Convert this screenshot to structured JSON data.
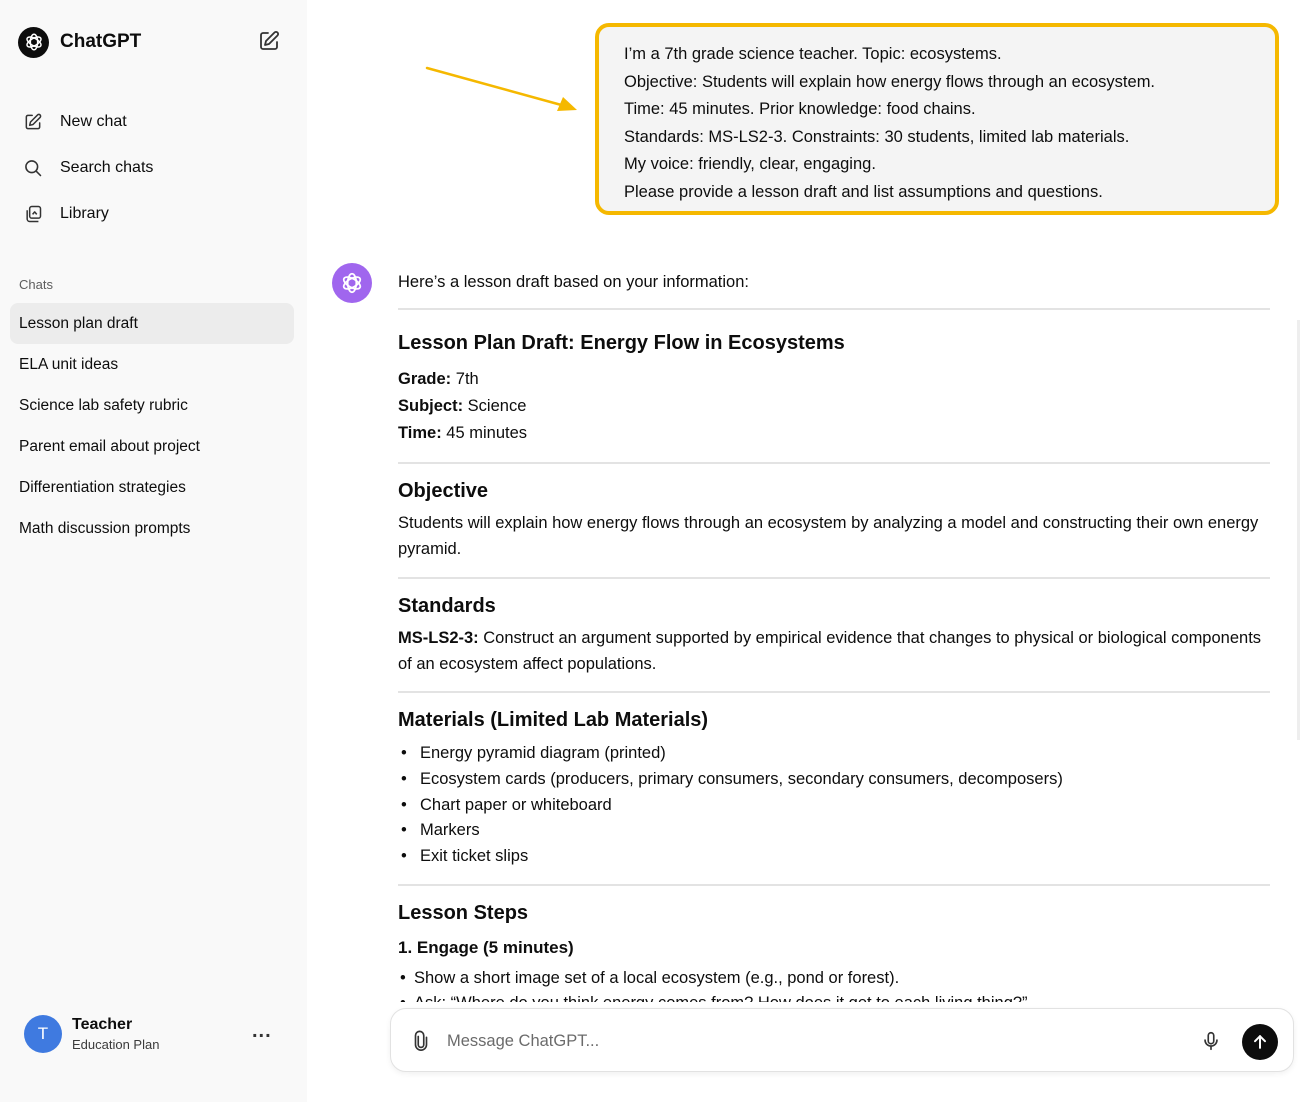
{
  "app": {
    "brand": "ChatGPT"
  },
  "sidebar": {
    "nav": [
      {
        "label": "New chat",
        "icon": "new-chat-icon"
      },
      {
        "label": "Search chats",
        "icon": "search-icon"
      },
      {
        "label": "Library",
        "icon": "library-icon"
      }
    ],
    "chats_heading": "Chats",
    "chats": [
      {
        "label": "Lesson plan draft",
        "active": true
      },
      {
        "label": "ELA unit ideas"
      },
      {
        "label": "Science lab safety rubric"
      },
      {
        "label": "Parent email about project"
      },
      {
        "label": "Differentiation strategies"
      },
      {
        "label": "Math discussion prompts"
      }
    ],
    "user": {
      "initial": "T",
      "name": "Teacher",
      "plan": "Education Plan",
      "more": "..."
    }
  },
  "conversation": {
    "user_message": [
      "I’m a 7th grade science teacher. Topic: ecosystems.",
      "Objective: Students will explain how energy flows through an ecosystem.",
      "Time: 45 minutes. Prior knowledge: food chains.",
      "Standards: MS-LS2-3.  Constraints: 30 students, limited lab materials.",
      "My voice: friendly, clear, engaging.",
      "Please provide a lesson draft and list assumptions and questions."
    ],
    "assistant": {
      "intro": "Here’s a lesson draft based on your information:",
      "title": "Lesson Plan Draft: Energy Flow in Ecosystems",
      "fields": [
        {
          "label": "Grade:",
          "value": " 7th"
        },
        {
          "label": "Subject:",
          "value": " Science"
        },
        {
          "label": "Time:",
          "value": " 45 minutes"
        }
      ],
      "objective_heading": "Objective",
      "objective_text": "Students will explain how energy flows through an ecosystem by analyzing a model and constructing their own energy pyramid.",
      "standards_heading": "Standards",
      "standard_code": "MS-LS2-3:",
      "standard_text": " Construct an argument supported by empirical evidence that changes to physical or biological components of an ecosystem affect populations.",
      "materials_heading": "Materials (Limited Lab Materials)",
      "materials": [
        "Energy pyramid diagram (printed)",
        "Ecosystem cards (producers, primary consumers, secondary consumers, decomposers)",
        "Chart paper or whiteboard",
        "Markers",
        "Exit ticket slips"
      ],
      "steps_heading": "Lesson Steps",
      "step1_heading": "1. Engage (5 minutes)",
      "step1_items": [
        "Show a short image set of a local ecosystem (e.g., pond or forest).",
        "Ask: “Where do you think energy comes from? How does it get to each living thing?”"
      ]
    }
  },
  "composer": {
    "placeholder": "Message ChatGPT..."
  },
  "colors": {
    "highlight_border": "#f5b800",
    "arrow": "#f5b800",
    "assistant_avatar": "#a066ee",
    "user_avatar": "#3f7ae0"
  }
}
